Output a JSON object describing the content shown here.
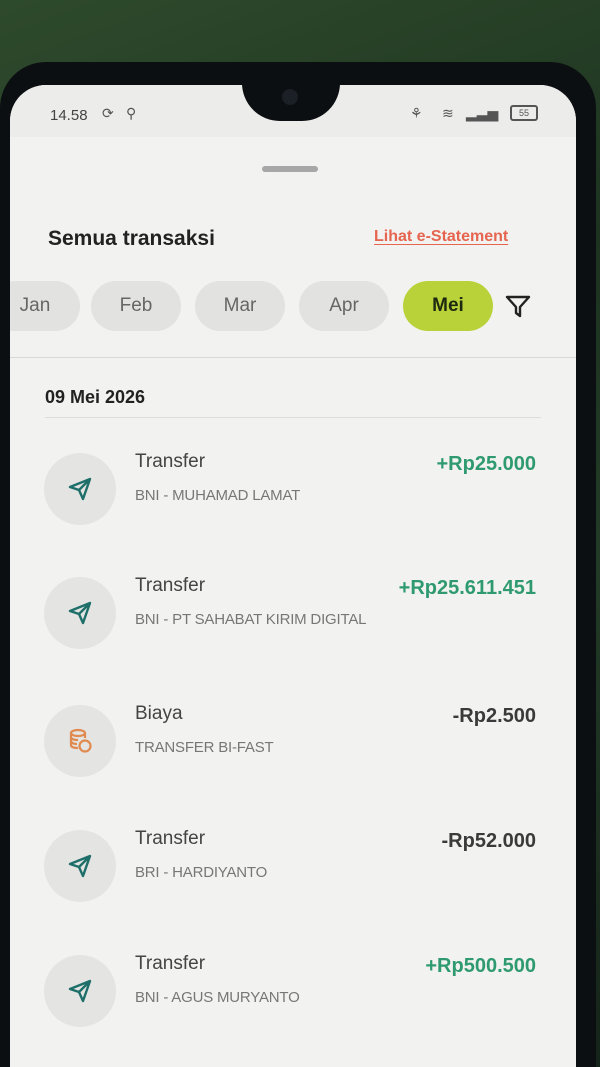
{
  "status_bar": {
    "time": "14.58",
    "battery": "55"
  },
  "sheet": {
    "title": "Semua transaksi",
    "e_statement_link": "Lihat e-Statement"
  },
  "months": [
    {
      "label": "Jan",
      "active": false
    },
    {
      "label": "Feb",
      "active": false
    },
    {
      "label": "Mar",
      "active": false
    },
    {
      "label": "Apr",
      "active": false
    },
    {
      "label": "Mei",
      "active": true
    }
  ],
  "date_header": "09 Mei 2026",
  "transactions": [
    {
      "type": "Transfer",
      "description": "BNI - MUHAMAD LAMAT",
      "amount": "+Rp25.000",
      "direction": "credit",
      "icon": "send-icon"
    },
    {
      "type": "Transfer",
      "description": "BNI - PT SAHABAT KIRIM DIGITAL",
      "amount": "+Rp25.611.451",
      "direction": "credit",
      "icon": "send-icon"
    },
    {
      "type": "Biaya",
      "description": "TRANSFER BI-FAST",
      "amount": "-Rp2.500",
      "direction": "debit",
      "icon": "coins-icon"
    },
    {
      "type": "Transfer",
      "description": "BRI - HARDIYANTO",
      "amount": "-Rp52.000",
      "direction": "debit",
      "icon": "send-icon"
    },
    {
      "type": "Transfer",
      "description": "BNI - AGUS MURYANTO",
      "amount": "+Rp500.500",
      "direction": "credit",
      "icon": "send-icon"
    }
  ],
  "colors": {
    "accent_chip": "#b9d23a",
    "credit": "#2f9a70",
    "debit": "#3a3a3a",
    "link": "#e5654f",
    "fee_icon": "#e08a4f",
    "send_icon": "#1e6f6a"
  }
}
